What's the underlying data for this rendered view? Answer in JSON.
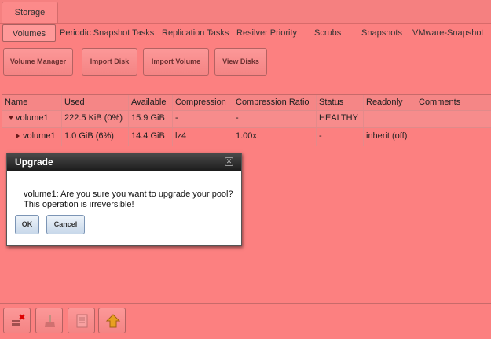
{
  "main_tab": {
    "label": "Storage"
  },
  "sub_tabs": [
    {
      "label": "Volumes",
      "active": true
    },
    {
      "label": "Periodic Snapshot Tasks"
    },
    {
      "label": "Replication Tasks"
    },
    {
      "label": "Resilver Priority"
    },
    {
      "label": "Scrubs"
    },
    {
      "label": "Snapshots"
    },
    {
      "label": "VMware-Snapshot"
    }
  ],
  "toolbar": {
    "volume_manager": "Volume Manager",
    "import_disk": "Import Disk",
    "import_volume": "Import Volume",
    "view_disks": "View Disks"
  },
  "table": {
    "columns": [
      "Name",
      "Used",
      "Available",
      "Compression",
      "Compression Ratio",
      "Status",
      "Readonly",
      "Comments"
    ],
    "rows": [
      {
        "name": "volume1",
        "used": "222.5 KiB (0%)",
        "available": "15.9 GiB",
        "compression": "-",
        "compression_ratio": "-",
        "status": "HEALTHY",
        "readonly": "",
        "comments": ""
      },
      {
        "name": "volume1",
        "used": "1.0 GiB (6%)",
        "available": "14.4 GiB",
        "compression": "lz4",
        "compression_ratio": "1.00x",
        "status": "-",
        "readonly": "inherit (off)",
        "comments": ""
      }
    ]
  },
  "dialog": {
    "title": "Upgrade",
    "close_glyph": "✕",
    "message_line1": "volume1: Are you sure you want to upgrade your pool?",
    "message_line2": "This operation is irreversible!",
    "ok_label": "OK",
    "cancel_label": "Cancel"
  },
  "bottom_actions": [
    {
      "icon": "detach-volume-icon"
    },
    {
      "icon": "scrub-volume-icon"
    },
    {
      "icon": "volume-status-icon"
    },
    {
      "icon": "upgrade-volume-icon"
    }
  ],
  "colors": {
    "background": "#fc8080",
    "dialog_title": "#1a1a1a",
    "button_blue": "#c8d8ea"
  }
}
